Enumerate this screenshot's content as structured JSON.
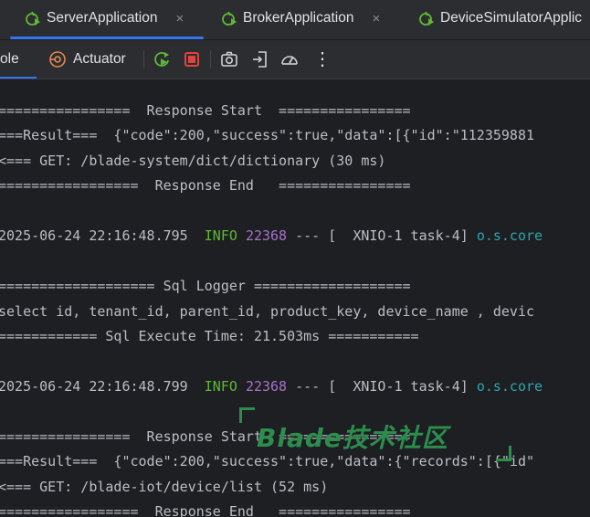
{
  "tabs": [
    {
      "label": "ServerApplication",
      "icon": "spring-run-icon",
      "active": true
    },
    {
      "label": "BrokerApplication",
      "icon": "spring-run-icon",
      "active": false
    },
    {
      "label": "DeviceSimulatorApplic",
      "icon": "spring-run-icon",
      "active": false
    }
  ],
  "close_glyph": "×",
  "toolbar": {
    "console_label": "ole",
    "actuator_label": "Actuator",
    "icons": [
      "actuator-icon",
      "rerun-icon",
      "stop-icon",
      "camera-icon",
      "login-icon",
      "gauge-icon",
      "more-icon"
    ],
    "more_glyph": "⋮"
  },
  "console": {
    "lines": [
      {
        "text": "================  Response Start  ================"
      },
      {
        "text": "===Result===  {\"code\":200,\"success\":true,\"data\":[{\"id\":\"112359881"
      },
      {
        "text": "<=== GET: /blade-system/dict/dictionary (30 ms)"
      },
      {
        "text": "=================  Response End   ================"
      },
      {
        "text": ""
      },
      {
        "ts": "2025-06-24 22:16:48.795",
        "level": "INFO",
        "pid": "22368",
        "rest": " --- [  XNIO-1 task-4] ",
        "logger": "o.s.core"
      },
      {
        "text": ""
      },
      {
        "text": "=================== Sql Logger ==================="
      },
      {
        "text": "select id, tenant_id, parent_id, product_key, device_name , devic"
      },
      {
        "text": "============ Sql Execute Time: 21.503ms ==========="
      },
      {
        "text": ""
      },
      {
        "ts": "2025-06-24 22:16:48.799",
        "level": "INFO",
        "pid": "22368",
        "rest": " --- [  XNIO-1 task-4] ",
        "logger": "o.s.core"
      },
      {
        "text": ""
      },
      {
        "text": "================  Response Start  ================"
      },
      {
        "text": "===Result===  {\"code\":200,\"success\":true,\"data\":{\"records\":[{\"id\""
      },
      {
        "text": "<=== GET: /blade-iot/device/list (52 ms)"
      },
      {
        "text": "=================  Response End   ================"
      }
    ]
  },
  "watermark": "Blade技术社区",
  "colors": {
    "accent": "#3574f0",
    "info": "#5fb832",
    "pid": "#a672c8",
    "logger": "#2aa7ad",
    "stop": "#e0443e"
  }
}
